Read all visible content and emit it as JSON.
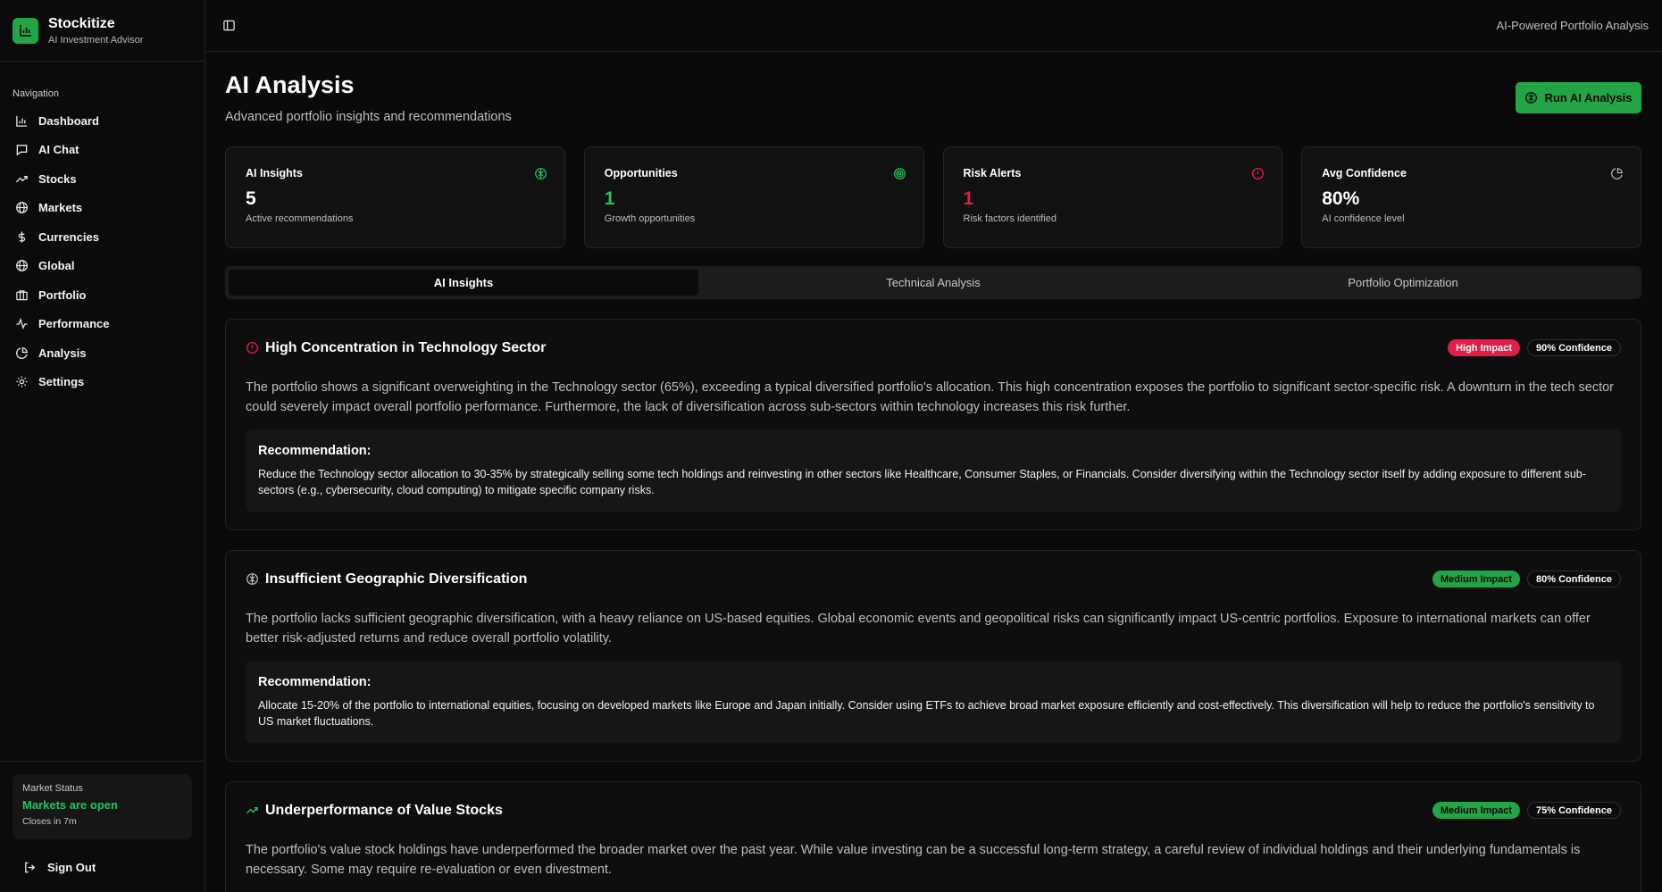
{
  "brand": {
    "name": "Stockitize",
    "subtitle": "AI Investment Advisor"
  },
  "sidebar": {
    "heading": "Navigation",
    "items": [
      {
        "label": "Dashboard",
        "icon": "bar-chart-icon"
      },
      {
        "label": "AI Chat",
        "icon": "chat-icon"
      },
      {
        "label": "Stocks",
        "icon": "trending-up-icon"
      },
      {
        "label": "Markets",
        "icon": "globe-icon"
      },
      {
        "label": "Currencies",
        "icon": "dollar-icon"
      },
      {
        "label": "Global",
        "icon": "globe-icon"
      },
      {
        "label": "Portfolio",
        "icon": "briefcase-icon"
      },
      {
        "label": "Performance",
        "icon": "activity-icon"
      },
      {
        "label": "Analysis",
        "icon": "pie-chart-icon"
      },
      {
        "label": "Settings",
        "icon": "gear-icon"
      }
    ],
    "market": {
      "label": "Market Status",
      "status": "Markets are open",
      "closes": "Closes in 7m"
    },
    "signout": "Sign Out"
  },
  "topbar": {
    "right_text": "AI-Powered Portfolio Analysis"
  },
  "page": {
    "title": "AI Analysis",
    "subtitle": "Advanced portfolio insights and recommendations",
    "run_button": "Run AI Analysis"
  },
  "stats": [
    {
      "title": "AI Insights",
      "value": "5",
      "desc": "Active recommendations",
      "icon": "brain-icon",
      "color": "#ffffff",
      "icon_color": "#22c55e"
    },
    {
      "title": "Opportunities",
      "value": "1",
      "desc": "Growth opportunities",
      "icon": "target-icon",
      "color": "#22c55e",
      "icon_color": "#22c55e"
    },
    {
      "title": "Risk Alerts",
      "value": "1",
      "desc": "Risk factors identified",
      "icon": "alert-circle-icon",
      "color": "#e11d48",
      "icon_color": "#e11d48"
    },
    {
      "title": "Avg Confidence",
      "value": "80%",
      "desc": "AI confidence level",
      "icon": "pie-chart-icon",
      "color": "#ffffff",
      "icon_color": "#bdbdbd"
    }
  ],
  "tabs": [
    {
      "label": "AI Insights",
      "active": true
    },
    {
      "label": "Technical Analysis",
      "active": false
    },
    {
      "label": "Portfolio Optimization",
      "active": false
    }
  ],
  "insights": [
    {
      "title": "High Concentration in Technology Sector",
      "icon": "alert-circle-icon",
      "impact": "High Impact",
      "confidence": "90% Confidence",
      "body": "The portfolio shows a significant overweighting in the Technology sector (65%), exceeding a typical diversified portfolio's allocation. This high concentration exposes the portfolio to significant sector-specific risk. A downturn in the tech sector could severely impact overall portfolio performance. Furthermore, the lack of diversification across sub-sectors within technology increases this risk further.",
      "rec_title": "Recommendation:",
      "rec_body": "Reduce the Technology sector allocation to 30-35% by strategically selling some tech holdings and reinvesting in other sectors like Healthcare, Consumer Staples, or Financials. Consider diversifying within the Technology sector itself by adding exposure to different sub-sectors (e.g., cybersecurity, cloud computing) to mitigate specific company risks."
    },
    {
      "title": "Insufficient Geographic Diversification",
      "icon": "brain-icon",
      "impact": "Medium Impact",
      "confidence": "80% Confidence",
      "body": "The portfolio lacks sufficient geographic diversification, with a heavy reliance on US-based equities. Global economic events and geopolitical risks can significantly impact US-centric portfolios. Exposure to international markets can offer better risk-adjusted returns and reduce overall portfolio volatility.",
      "rec_title": "Recommendation:",
      "rec_body": "Allocate 15-20% of the portfolio to international equities, focusing on developed markets like Europe and Japan initially. Consider using ETFs to achieve broad market exposure efficiently and cost-effectively. This diversification will help to reduce the portfolio's sensitivity to US market fluctuations."
    },
    {
      "title": "Underperformance of Value Stocks",
      "icon": "trending-up-icon",
      "impact": "Medium Impact",
      "confidence": "75% Confidence",
      "body": "The portfolio's value stock holdings have underperformed the broader market over the past year. While value investing can be a successful long-term strategy, a careful review of individual holdings and their underlying fundamentals is necessary. Some may require re-evaluation or even divestment."
    }
  ]
}
